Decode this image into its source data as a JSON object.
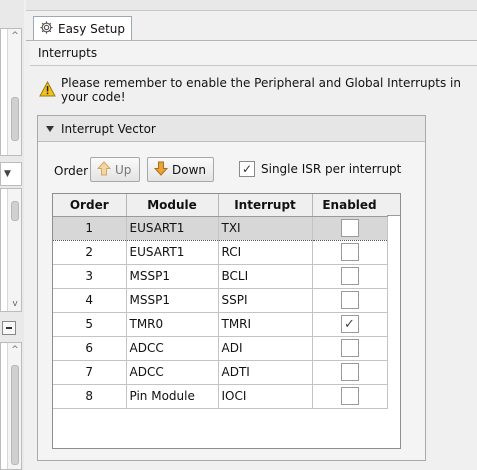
{
  "tab": {
    "label": "Easy Setup",
    "icon": "gear-icon"
  },
  "section": {
    "title": "Interrupts"
  },
  "warning": {
    "text": "Please remember to enable the Peripheral and Global Interrupts in your code!",
    "icon": "warning-icon"
  },
  "panel": {
    "title": "Interrupt Vector",
    "order_label": "Order",
    "up_label": "Up",
    "down_label": "Down",
    "single_isr_label": "Single ISR per interrupt",
    "single_isr_checked": true
  },
  "table": {
    "headers": {
      "order": "Order",
      "module": "Module",
      "interrupt": "Interrupt",
      "enabled": "Enabled"
    },
    "rows": [
      {
        "order": "1",
        "module": "EUSART1",
        "interrupt": "TXI",
        "enabled": false,
        "selected": true
      },
      {
        "order": "2",
        "module": "EUSART1",
        "interrupt": "RCI",
        "enabled": false,
        "selected": false
      },
      {
        "order": "3",
        "module": "MSSP1",
        "interrupt": "BCLI",
        "enabled": false,
        "selected": false
      },
      {
        "order": "4",
        "module": "MSSP1",
        "interrupt": "SSPI",
        "enabled": false,
        "selected": false
      },
      {
        "order": "5",
        "module": "TMR0",
        "interrupt": "TMRI",
        "enabled": true,
        "selected": false
      },
      {
        "order": "6",
        "module": "ADCC",
        "interrupt": "ADI",
        "enabled": false,
        "selected": false
      },
      {
        "order": "7",
        "module": "ADCC",
        "interrupt": "ADTI",
        "enabled": false,
        "selected": false
      },
      {
        "order": "8",
        "module": "Pin Module",
        "interrupt": "IOCI",
        "enabled": false,
        "selected": false
      }
    ]
  },
  "colors": {
    "selected_row": "#d7d7d7",
    "warning_yellow": "#f2c21b",
    "arrow_orange": "#e8a33a"
  }
}
